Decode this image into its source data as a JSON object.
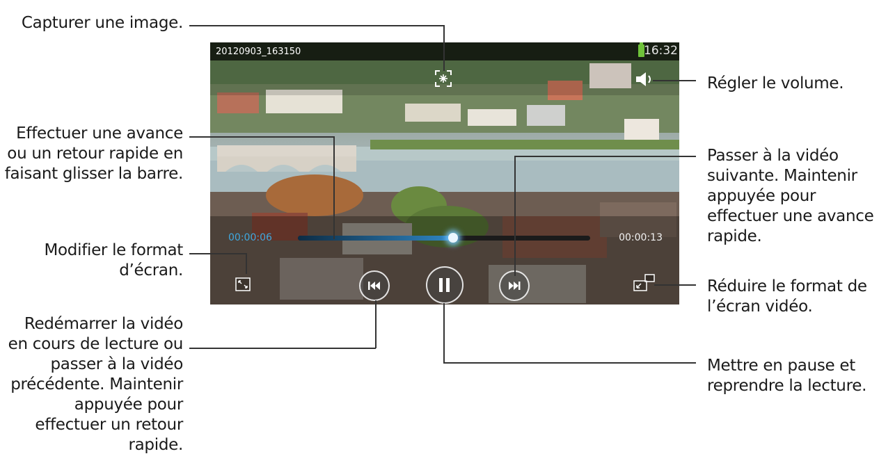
{
  "screen": {
    "filename": "20120903_163150",
    "clock": "16:32",
    "elapsed": "00:00:06",
    "duration": "00:00:13",
    "progress_fraction": 0.53
  },
  "icons": {
    "capture": "capture-icon",
    "volume": "volume-icon",
    "aspect": "aspect-ratio-icon",
    "rewind": "rewind-icon",
    "pause": "pause-icon",
    "forward": "fast-forward-icon",
    "popup": "popup-play-icon",
    "battery": "battery-icon"
  },
  "colors": {
    "accent": "#3fa9e0",
    "battery": "#6fc23a"
  },
  "callouts": {
    "capture": "Capturer une image.",
    "volume": "Régler le volume.",
    "seek": [
      "Effectuer une avance",
      "ou un retour rapide en",
      "faisant glisser la barre."
    ],
    "next": [
      "Passer à la vidéo",
      "suivante. Maintenir",
      "appuyée pour",
      "effectuer une avance",
      "rapide."
    ],
    "format": [
      "Modifier le format",
      "d’écran."
    ],
    "reduce": [
      "Réduire le format de",
      "l’écran vidéo."
    ],
    "prev": [
      "Redémarrer la vidéo",
      "en cours de lecture ou",
      "passer à la vidéo",
      "précédente. Maintenir",
      "appuyée pour",
      "effectuer un retour",
      "rapide."
    ],
    "pause": [
      "Mettre en pause et",
      "reprendre la lecture."
    ]
  }
}
